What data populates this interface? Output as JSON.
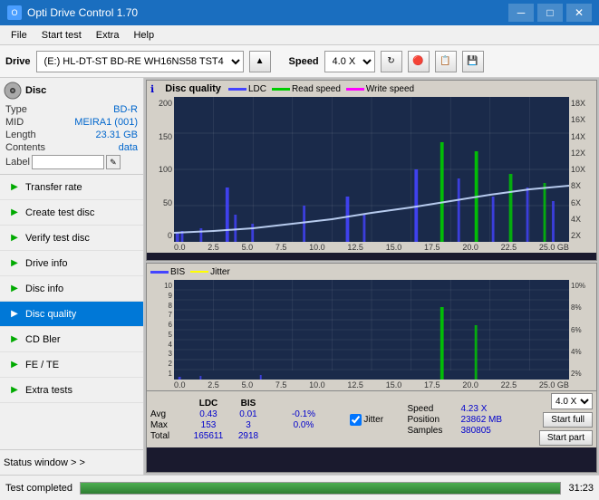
{
  "titlebar": {
    "title": "Opti Drive Control 1.70",
    "icon": "O",
    "min_label": "─",
    "max_label": "□",
    "close_label": "✕"
  },
  "menu": {
    "items": [
      "File",
      "Start test",
      "Extra",
      "Help"
    ]
  },
  "toolbar": {
    "drive_label": "Drive",
    "drive_value": "(E:)  HL-DT-ST BD-RE  WH16NS58 TST4",
    "speed_label": "Speed",
    "speed_value": "4.0 X"
  },
  "sidebar": {
    "disc_header": "Disc",
    "type_label": "Type",
    "type_value": "BD-R",
    "mid_label": "MID",
    "mid_value": "MEIRA1 (001)",
    "length_label": "Length",
    "length_value": "23.31 GB",
    "contents_label": "Contents",
    "contents_value": "data",
    "label_label": "Label",
    "label_placeholder": "",
    "items": [
      {
        "id": "transfer-rate",
        "label": "Transfer rate",
        "icon": "▶"
      },
      {
        "id": "create-test-disc",
        "label": "Create test disc",
        "icon": "▶"
      },
      {
        "id": "verify-test-disc",
        "label": "Verify test disc",
        "icon": "▶"
      },
      {
        "id": "drive-info",
        "label": "Drive info",
        "icon": "▶"
      },
      {
        "id": "disc-info",
        "label": "Disc info",
        "icon": "▶"
      },
      {
        "id": "disc-quality",
        "label": "Disc quality",
        "icon": "▶",
        "active": true
      },
      {
        "id": "cd-bler",
        "label": "CD Bler",
        "icon": "▶"
      },
      {
        "id": "fe-te",
        "label": "FE / TE",
        "icon": "▶"
      },
      {
        "id": "extra-tests",
        "label": "Extra tests",
        "icon": "▶"
      }
    ],
    "status_window": "Status window > >"
  },
  "chart_top": {
    "title": "Disc quality",
    "legend": [
      {
        "id": "ldc",
        "label": "LDC",
        "color": "#4444ff"
      },
      {
        "id": "read",
        "label": "Read speed",
        "color": "#00cc00"
      },
      {
        "id": "write",
        "label": "Write speed",
        "color": "#ff00ff"
      }
    ],
    "y_left": [
      "200",
      "150",
      "100",
      "50",
      "0"
    ],
    "y_right": [
      "18X",
      "16X",
      "14X",
      "12X",
      "10X",
      "8X",
      "6X",
      "4X",
      "2X"
    ],
    "x_axis": [
      "0.0",
      "2.5",
      "5.0",
      "7.5",
      "10.0",
      "12.5",
      "15.0",
      "17.5",
      "20.0",
      "22.5",
      "25.0 GB"
    ]
  },
  "chart_bottom": {
    "legend": [
      {
        "id": "bis",
        "label": "BIS",
        "color": "#4444ff"
      },
      {
        "id": "jitter",
        "label": "Jitter",
        "color": "#ffff00"
      }
    ],
    "y_left": [
      "10",
      "9",
      "8",
      "7",
      "6",
      "5",
      "4",
      "3",
      "2",
      "1"
    ],
    "y_right": [
      "10%",
      "8%",
      "6%",
      "4%",
      "2%"
    ],
    "x_axis": [
      "0.0",
      "2.5",
      "5.0",
      "7.5",
      "10.0",
      "12.5",
      "15.0",
      "17.5",
      "20.0",
      "22.5",
      "25.0 GB"
    ]
  },
  "stats": {
    "col_headers": [
      "",
      "LDC",
      "BIS",
      "",
      "Jitter",
      "Speed",
      ""
    ],
    "avg_label": "Avg",
    "avg_ldc": "0.43",
    "avg_bis": "0.01",
    "avg_jitter": "-0.1%",
    "max_label": "Max",
    "max_ldc": "153",
    "max_bis": "3",
    "max_jitter": "0.0%",
    "total_label": "Total",
    "total_ldc": "165611",
    "total_bis": "2918",
    "speed_label": "Speed",
    "speed_value": "4.23 X",
    "speed_select": "4.0 X",
    "position_label": "Position",
    "position_value": "23862 MB",
    "samples_label": "Samples",
    "samples_value": "380805",
    "jitter_checked": true,
    "start_full": "Start full",
    "start_part": "Start part"
  },
  "statusbar": {
    "status_text": "Test completed",
    "progress": 100,
    "time": "31:23"
  }
}
